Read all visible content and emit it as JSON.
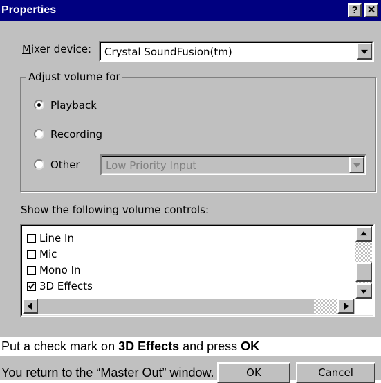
{
  "window": {
    "title": "Properties",
    "help_button": "?",
    "close_button": "✕"
  },
  "mixer": {
    "label_accesskey": "M",
    "label_rest": "ixer device:",
    "value": "Crystal SoundFusion(tm)"
  },
  "adjust_volume": {
    "title": "Adjust volume for",
    "options": [
      {
        "label": "Playback",
        "selected": true
      },
      {
        "label": "Recording",
        "selected": false
      },
      {
        "label": "Other",
        "selected": false
      }
    ],
    "other_value": "Low Priority Input"
  },
  "controls": {
    "label": "Show the following volume controls:",
    "items": [
      {
        "label": "Line In",
        "checked": false
      },
      {
        "label": "Mic",
        "checked": false
      },
      {
        "label": "Mono In",
        "checked": false
      },
      {
        "label": "3D Effects",
        "checked": true
      }
    ]
  },
  "buttons": {
    "ok": "OK",
    "cancel": "Cancel"
  },
  "caption": {
    "line1_pre": "Put a check mark on ",
    "line1_bold1": "3D Effects",
    "line1_mid": " and press ",
    "line1_bold2": "OK",
    "line2": "You return to the “Master Out” window."
  },
  "colors": {
    "titlebar": "#000080",
    "face": "#c0c0c0",
    "disabled_text": "#808080"
  }
}
